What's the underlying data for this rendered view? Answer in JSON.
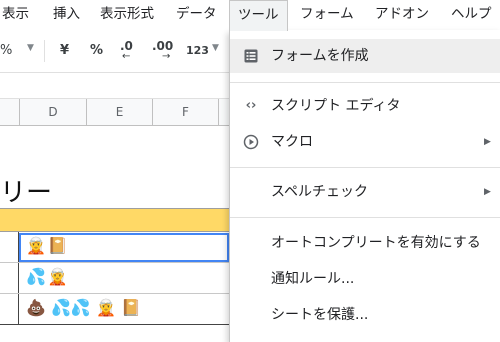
{
  "menubar": {
    "items": [
      "表示",
      "挿入",
      "表示形式",
      "データ",
      "ツール",
      "フォーム",
      "アドオン",
      "ヘルプ"
    ],
    "active": "ツール"
  },
  "toolbar": {
    "percent_format": "%",
    "currency": "¥",
    "percent": "%",
    "decrease_decimal": ".0",
    "increase_decimal": ".00",
    "more_formats": "123"
  },
  "columns": [
    "D",
    "E",
    "F"
  ],
  "sheet": {
    "title_fragment": "リー",
    "rows": [
      {
        "content": "🧝📔"
      },
      {
        "content": "💦🧝"
      },
      {
        "content": "💩 💦💦 🧝 📔"
      }
    ]
  },
  "tools_menu": {
    "items": [
      {
        "label": "フォームを作成",
        "icon": "form-icon"
      },
      {
        "label": "スクリプト エディタ",
        "icon": "code-icon"
      },
      {
        "label": "マクロ",
        "icon": "play-icon",
        "submenu": true
      },
      {
        "label": "スペルチェック",
        "submenu": true
      },
      {
        "label": "オートコンプリートを有効にする"
      },
      {
        "label": "通知ルール..."
      },
      {
        "label": "シートを保護..."
      }
    ]
  },
  "colors": {
    "header_yellow": "#ffd966",
    "selection_blue": "#4285f4",
    "menu_hover": "#eeeeee"
  }
}
